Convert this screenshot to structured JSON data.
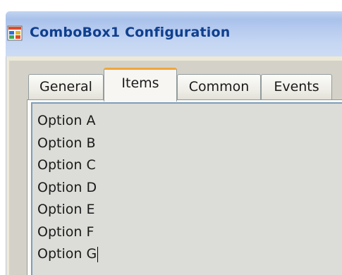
{
  "window": {
    "title": "ComboBox1 Configuration",
    "icon": "app-window-icon"
  },
  "tabs": [
    {
      "label": "General",
      "selected": false
    },
    {
      "label": "Items",
      "selected": true
    },
    {
      "label": "Common",
      "selected": false
    },
    {
      "label": "Events",
      "selected": false
    }
  ],
  "items_editor": {
    "lines": [
      "Option A",
      "Option B",
      "Option C",
      "Option D",
      "Option E",
      "Option F",
      "Option G"
    ],
    "caret_after_line": 6
  },
  "colors": {
    "title_text": "#0f3f8e",
    "selected_tab_accent": "#f0a53a",
    "dialog_bg": "#ece9d8"
  }
}
